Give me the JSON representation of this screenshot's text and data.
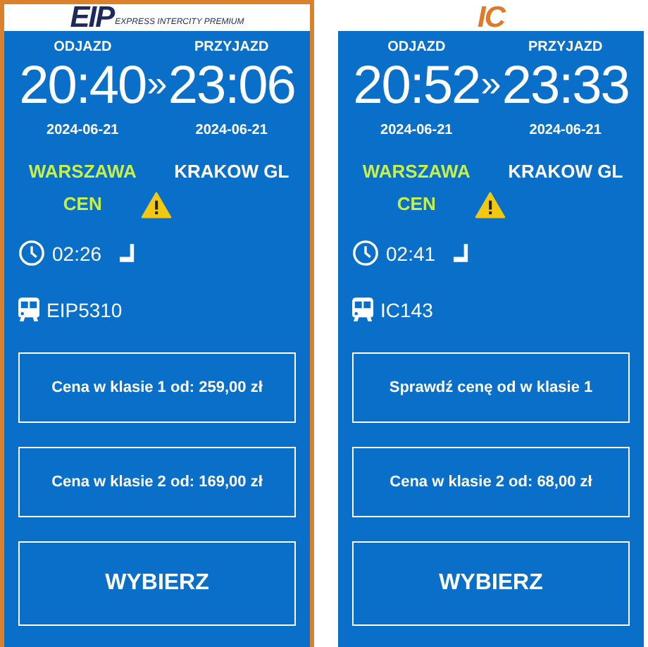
{
  "connections": [
    {
      "selected": true,
      "logo": {
        "main": "EIP",
        "sub": "EXPRESS INTERCITY PREMIUM",
        "color": "#1d2a5c"
      },
      "departure_label": "ODJAZD",
      "arrival_label": "PRZYJAZD",
      "departure_time": "20:40",
      "separator": "»",
      "arrival_time": "23:06",
      "departure_date": "2024-06-21",
      "arrival_date": "2024-06-21",
      "departure_station": "WARSZAWA CEN",
      "departure_warning": true,
      "arrival_station": "KRAKOW GL",
      "duration": "02:26",
      "train": "EIP5310",
      "buttons": [
        {
          "kind": "price",
          "label": "Cena w klasie 1 od: 259,00 zł"
        },
        {
          "kind": "price",
          "label": "Cena w klasie 2 od: 169,00 zł"
        },
        {
          "kind": "choose",
          "label": "WYBIERZ"
        }
      ]
    },
    {
      "selected": false,
      "logo": {
        "main": "IC",
        "color": "#e07a2a"
      },
      "departure_label": "ODJAZD",
      "arrival_label": "PRZYJAZD",
      "departure_time": "20:52",
      "separator": "»",
      "arrival_time": "23:33",
      "departure_date": "2024-06-21",
      "arrival_date": "2024-06-21",
      "departure_station": "WARSZAWA CEN",
      "departure_warning": true,
      "arrival_station": "KRAKOW GL",
      "duration": "02:41",
      "train": "IC143",
      "buttons": [
        {
          "kind": "price",
          "label": "Sprawdź cenę od w klasie 1"
        },
        {
          "kind": "price",
          "label": "Cena w klasie 2 od: 68,00 zł"
        },
        {
          "kind": "choose",
          "label": "WYBIERZ"
        }
      ]
    }
  ]
}
